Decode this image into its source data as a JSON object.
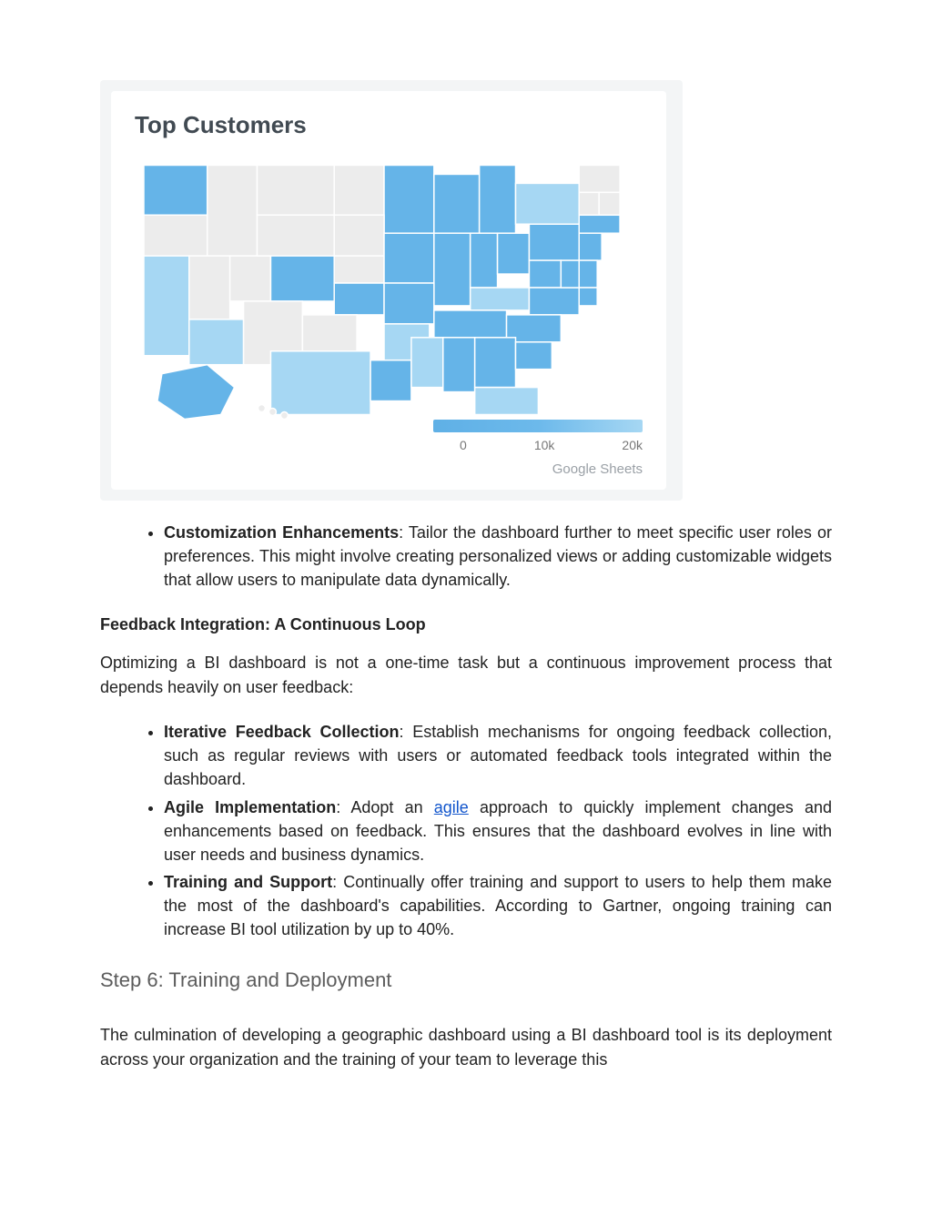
{
  "map": {
    "title": "Top Customers",
    "legend": {
      "ticks": [
        "0",
        "10k",
        "20k"
      ]
    },
    "source": "Google Sheets"
  },
  "bullet1": {
    "label": "Customization Enhancements",
    "text": ": Tailor the dashboard further to meet specific user roles or preferences. This might involve creating personalized views or adding customizable widgets that allow users to manipulate data dynamically."
  },
  "sectionSub": "Feedback Integration: A Continuous Loop",
  "introP": "Optimizing a BI dashboard is not a one-time task but a continuous improvement process that depends heavily on user feedback:",
  "list2": {
    "item1": {
      "label": "Iterative Feedback Collection",
      "text": ": Establish mechanisms for ongoing feedback collection, such as regular reviews with users or automated feedback tools integrated within the dashboard."
    },
    "item2": {
      "label": "Agile Implementation",
      "pre": ": Adopt an ",
      "link": "agile",
      "post": " approach to quickly implement changes and enhancements based on feedback. This ensures that the dashboard evolves in line with user needs and business dynamics."
    },
    "item3": {
      "label": "Training and Support",
      "text": ": Continually offer training and support to users to help them make the most of the dashboard's capabilities. According to Gartner, ongoing training can increase BI tool utilization by up to 40%."
    }
  },
  "stepHeading": "Step 6: Training and Deployment",
  "finalP": "The culmination of developing a geographic dashboard using a BI dashboard tool is its deployment across your organization and the training of your team to leverage this",
  "chart_data": {
    "type": "map",
    "title": "Top Customers",
    "region": "United States",
    "tint_scale": {
      "min": 0,
      "max": 20000,
      "ticks": [
        0,
        10000,
        20000
      ]
    },
    "states": [
      {
        "state": "WA",
        "tint": "medium"
      },
      {
        "state": "OR",
        "tint": "none"
      },
      {
        "state": "CA",
        "tint": "light"
      },
      {
        "state": "NV",
        "tint": "none"
      },
      {
        "state": "ID",
        "tint": "none"
      },
      {
        "state": "MT",
        "tint": "none"
      },
      {
        "state": "WY",
        "tint": "none"
      },
      {
        "state": "UT",
        "tint": "none"
      },
      {
        "state": "AZ",
        "tint": "light"
      },
      {
        "state": "CO",
        "tint": "medium"
      },
      {
        "state": "NM",
        "tint": "none"
      },
      {
        "state": "ND",
        "tint": "none"
      },
      {
        "state": "SD",
        "tint": "none"
      },
      {
        "state": "NE",
        "tint": "none"
      },
      {
        "state": "KS",
        "tint": "medium"
      },
      {
        "state": "OK",
        "tint": "none"
      },
      {
        "state": "TX",
        "tint": "light"
      },
      {
        "state": "MN",
        "tint": "medium"
      },
      {
        "state": "IA",
        "tint": "medium"
      },
      {
        "state": "MO",
        "tint": "medium"
      },
      {
        "state": "AR",
        "tint": "light"
      },
      {
        "state": "LA",
        "tint": "medium"
      },
      {
        "state": "WI",
        "tint": "medium"
      },
      {
        "state": "IL",
        "tint": "medium"
      },
      {
        "state": "MI",
        "tint": "medium"
      },
      {
        "state": "IN",
        "tint": "medium"
      },
      {
        "state": "OH",
        "tint": "medium"
      },
      {
        "state": "KY",
        "tint": "light"
      },
      {
        "state": "TN",
        "tint": "medium"
      },
      {
        "state": "MS",
        "tint": "light"
      },
      {
        "state": "AL",
        "tint": "medium"
      },
      {
        "state": "GA",
        "tint": "medium"
      },
      {
        "state": "FL",
        "tint": "light"
      },
      {
        "state": "SC",
        "tint": "medium"
      },
      {
        "state": "NC",
        "tint": "medium"
      },
      {
        "state": "VA",
        "tint": "medium"
      },
      {
        "state": "WV",
        "tint": "medium"
      },
      {
        "state": "MD",
        "tint": "medium"
      },
      {
        "state": "DE",
        "tint": "medium"
      },
      {
        "state": "PA",
        "tint": "medium"
      },
      {
        "state": "NJ",
        "tint": "medium"
      },
      {
        "state": "NY",
        "tint": "light"
      },
      {
        "state": "CT",
        "tint": "medium"
      },
      {
        "state": "RI",
        "tint": "medium"
      },
      {
        "state": "MA",
        "tint": "medium"
      },
      {
        "state": "VT",
        "tint": "none"
      },
      {
        "state": "NH",
        "tint": "none"
      },
      {
        "state": "ME",
        "tint": "none"
      },
      {
        "state": "AK",
        "tint": "medium"
      },
      {
        "state": "HI",
        "tint": "none"
      }
    ]
  }
}
